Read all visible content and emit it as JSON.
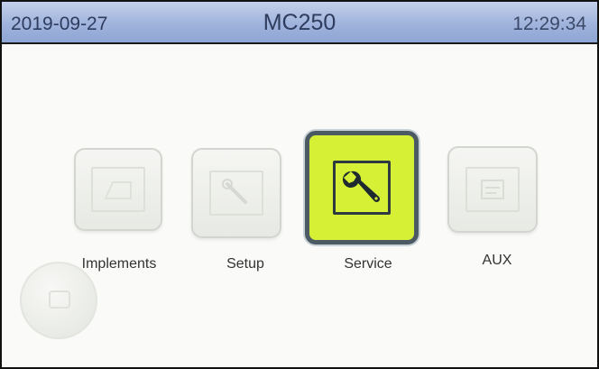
{
  "header": {
    "date": "2019-09-27",
    "title": "MC250",
    "time": "12:29:34"
  },
  "menu": {
    "items": [
      {
        "label": "Implements",
        "icon": "implements-icon",
        "state": "inactive"
      },
      {
        "label": "Setup",
        "icon": "wrench-icon",
        "state": "inactive"
      },
      {
        "label": "Service",
        "icon": "wrench-icon",
        "state": "selected"
      },
      {
        "label": "AUX",
        "icon": "aux-icon",
        "state": "inactive"
      }
    ]
  },
  "home_button": {
    "icon": "home-icon"
  },
  "colors": {
    "header_bg": "#9fb3dc",
    "header_text": "#2e3c5e",
    "selected_tile": "#d6f035",
    "selected_border": "#4c5a63",
    "inactive_tile": "#eceee9"
  }
}
